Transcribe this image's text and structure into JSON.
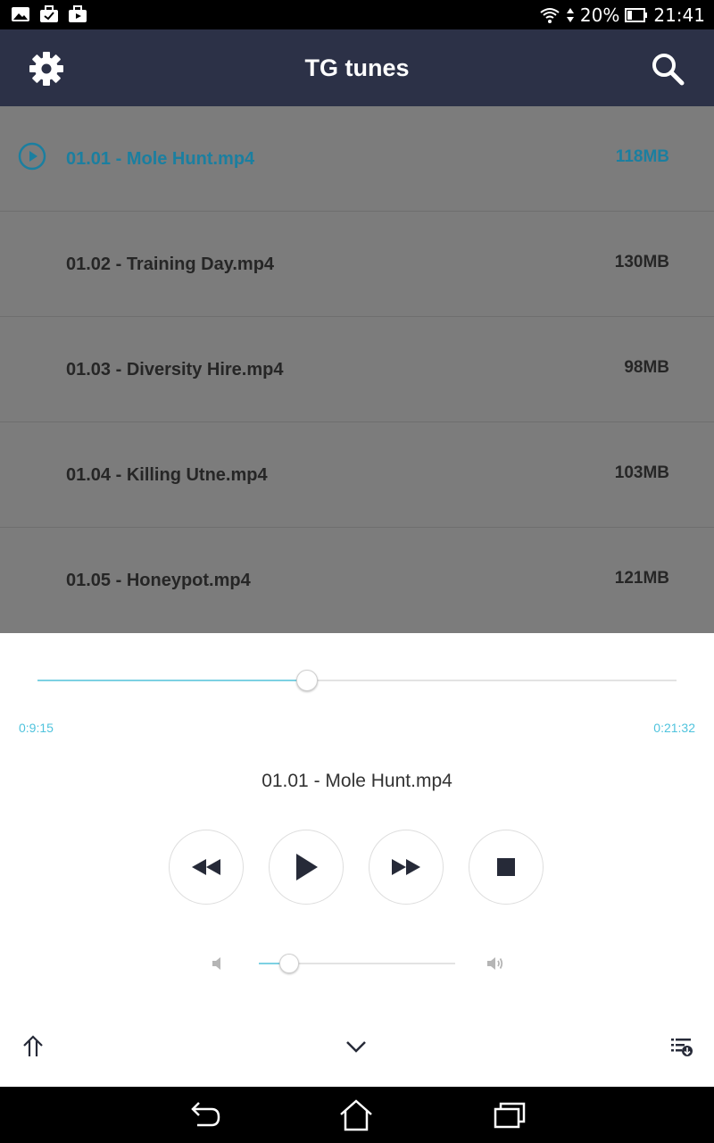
{
  "status_bar": {
    "battery_percent": "20%",
    "time": "21:41",
    "icons": [
      "gallery-icon",
      "briefcase-check-icon",
      "briefcase-play-icon",
      "wifi-icon",
      "data-arrows-icon",
      "battery-icon"
    ]
  },
  "app_bar": {
    "title": "TG tunes",
    "left_icon": "gear-icon",
    "right_icon": "search-icon"
  },
  "list": {
    "items": [
      {
        "name": "01.01 - Mole Hunt.mp4",
        "size": "118MB",
        "active": true
      },
      {
        "name": "01.02 - Training Day.mp4",
        "size": "130MB",
        "active": false
      },
      {
        "name": "01.03 - Diversity Hire.mp4",
        "size": "98MB",
        "active": false
      },
      {
        "name": "01.04 - Killing Utne.mp4",
        "size": "103MB",
        "active": false
      },
      {
        "name": "01.05 - Honeypot.mp4",
        "size": "121MB",
        "active": false
      }
    ]
  },
  "player": {
    "elapsed": "0:9:15",
    "total": "0:21:32",
    "progress_fraction": 0.42,
    "now_playing": "01.01 - Mole Hunt.mp4",
    "volume_fraction": 0.15,
    "controls": [
      "rewind-icon",
      "play-icon",
      "fast-forward-icon",
      "stop-icon"
    ],
    "bottom_icons": [
      "collapse-up-icon",
      "chevron-down-icon",
      "playlist-download-icon"
    ]
  },
  "nav_bar": {
    "icons": [
      "back-icon",
      "home-icon",
      "recents-icon"
    ]
  },
  "colors": {
    "app_bar": "#2c3147",
    "accent": "#4fc3dd",
    "active_item": "#1b7fa0",
    "list_overlay": "#7c7c7c"
  }
}
